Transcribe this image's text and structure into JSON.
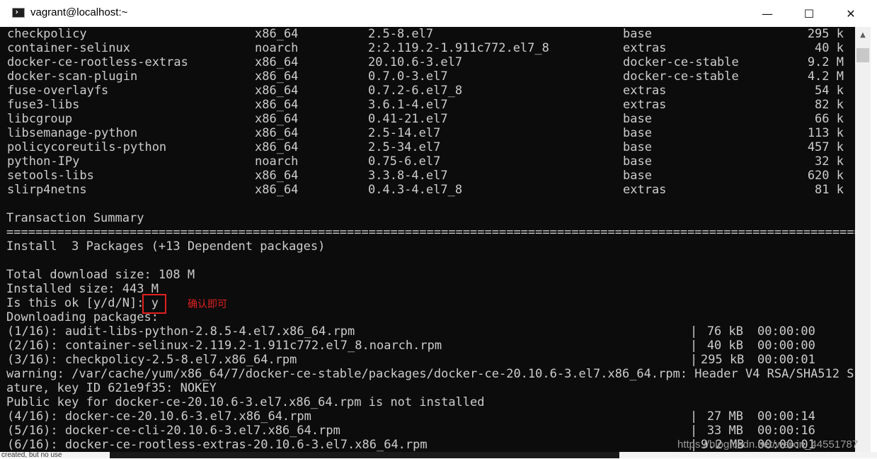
{
  "window": {
    "title": "vagrant@localhost:~",
    "minimize_glyph": "—",
    "maximize_glyph": "☐",
    "close_glyph": "✕"
  },
  "packages": [
    {
      "name": "checkpolicy",
      "arch": "x86_64",
      "version": "2.5-8.el7",
      "repo": "base",
      "size": "295 k"
    },
    {
      "name": "container-selinux",
      "arch": "noarch",
      "version": "2:2.119.2-1.911c772.el7_8",
      "repo": "extras",
      "size": "40 k"
    },
    {
      "name": "docker-ce-rootless-extras",
      "arch": "x86_64",
      "version": "20.10.6-3.el7",
      "repo": "docker-ce-stable",
      "size": "9.2 M"
    },
    {
      "name": "docker-scan-plugin",
      "arch": "x86_64",
      "version": "0.7.0-3.el7",
      "repo": "docker-ce-stable",
      "size": "4.2 M"
    },
    {
      "name": "fuse-overlayfs",
      "arch": "x86_64",
      "version": "0.7.2-6.el7_8",
      "repo": "extras",
      "size": "54 k"
    },
    {
      "name": "fuse3-libs",
      "arch": "x86_64",
      "version": "3.6.1-4.el7",
      "repo": "extras",
      "size": "82 k"
    },
    {
      "name": "libcgroup",
      "arch": "x86_64",
      "version": "0.41-21.el7",
      "repo": "base",
      "size": "66 k"
    },
    {
      "name": "libsemanage-python",
      "arch": "x86_64",
      "version": "2.5-14.el7",
      "repo": "base",
      "size": "113 k"
    },
    {
      "name": "policycoreutils-python",
      "arch": "x86_64",
      "version": "2.5-34.el7",
      "repo": "base",
      "size": "457 k"
    },
    {
      "name": "python-IPy",
      "arch": "noarch",
      "version": "0.75-6.el7",
      "repo": "base",
      "size": "32 k"
    },
    {
      "name": "setools-libs",
      "arch": "x86_64",
      "version": "3.3.8-4.el7",
      "repo": "base",
      "size": "620 k"
    },
    {
      "name": "slirp4netns",
      "arch": "x86_64",
      "version": "0.4.3-4.el7_8",
      "repo": "extras",
      "size": "81 k"
    }
  ],
  "summary": {
    "heading": "Transaction Summary",
    "separator": "================================================================================================================================",
    "install_line": "Install  3 Packages (+13 Dependent packages)",
    "total_download": "Total download size: 108 M",
    "installed_size": "Installed size: 443 M",
    "prompt": "Is this ok [y/d/N]: ",
    "answer": "y",
    "downloading": "Downloading packages:"
  },
  "annotation": "确认即可",
  "downloads_a": [
    {
      "file": "(1/16): audit-libs-python-2.8.5-4.el7.x86_64.rpm",
      "size": "76 kB",
      "time": "00:00:00"
    },
    {
      "file": "(2/16): container-selinux-2.119.2-1.911c772.el7_8.noarch.rpm",
      "size": "40 kB",
      "time": "00:00:00"
    },
    {
      "file": "(3/16): checkpolicy-2.5-8.el7.x86_64.rpm",
      "size": "295 kB",
      "time": "00:00:01"
    }
  ],
  "warning_lines": [
    "warning: /var/cache/yum/x86_64/7/docker-ce-stable/packages/docker-ce-20.10.6-3.el7.x86_64.rpm: Header V4 RSA/SHA512 Sign",
    "ature, key ID 621e9f35: NOKEY",
    "Public key for docker-ce-20.10.6-3.el7.x86_64.rpm is not installed"
  ],
  "downloads_b": [
    {
      "file": "(4/16): docker-ce-20.10.6-3.el7.x86_64.rpm",
      "size": "27 MB",
      "time": "00:00:14"
    },
    {
      "file": "(5/16): docker-ce-cli-20.10.6-3.el7.x86_64.rpm",
      "size": "33 MB",
      "time": "00:00:16"
    },
    {
      "file": "(6/16): docker-ce-rootless-extras-20.10.6-3.el7.x86_64.rpm",
      "size": "9.2 MB",
      "time": "00:00:01"
    }
  ],
  "pipe": "|",
  "background_fragment": "created, but no use",
  "watermark": "https://blog.csdn.net/weixin_44551787"
}
